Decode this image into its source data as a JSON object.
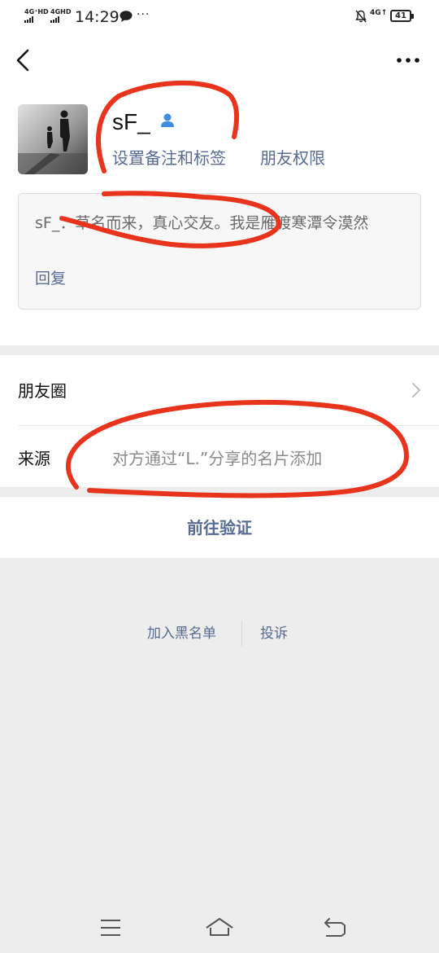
{
  "status_bar": {
    "sim1": "4G⁺HD",
    "sim2": "4GHD",
    "time": "14:29",
    "more": "···",
    "network": "4G↑",
    "battery": "41"
  },
  "nav": {
    "back_icon": "chevron-left-icon",
    "more_icon": "more-dots-icon"
  },
  "profile": {
    "nickname": "sF_",
    "gender_icon": "person-icon",
    "set_remark_label": "设置备注和标签",
    "friend_permission_label": "朋友权限"
  },
  "moment": {
    "text": "sF_：草名而来，真心交友。我是雁渡寒潭令漠然",
    "reply_label": "回复"
  },
  "list": {
    "moments_label": "朋友圈",
    "source_label": "来源",
    "source_value": "对方通过“L.”分享的名片添加"
  },
  "verify": {
    "label": "前往验证"
  },
  "bottom": {
    "blacklist_label": "加入黑名单",
    "report_label": "投诉"
  },
  "colors": {
    "link": "#576b95",
    "annotation": "#e8341c",
    "background": "#ededed"
  }
}
